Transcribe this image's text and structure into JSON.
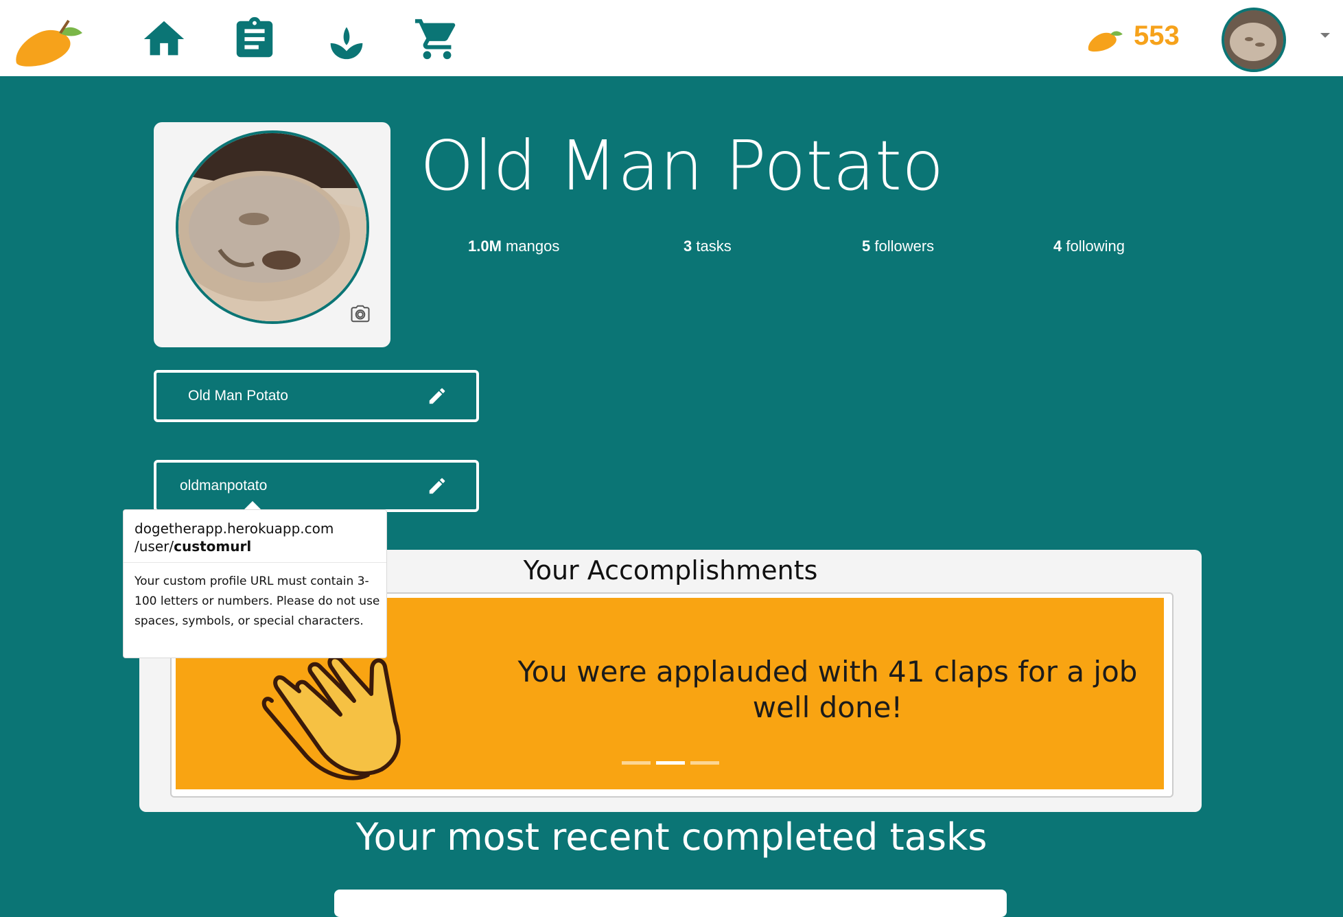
{
  "nav": {
    "mango_count": "553",
    "icons": [
      "home-icon",
      "clipboard-icon",
      "sprout-icon",
      "cart-icon"
    ]
  },
  "profile": {
    "name": "Old Man Potato",
    "stats": {
      "mangos_value": "1.0M",
      "mangos_label": "mangos",
      "tasks_value": "3",
      "tasks_label": "tasks",
      "followers_value": "5",
      "followers_label": "followers",
      "following_value": "4",
      "following_label": "following"
    },
    "display_name_field": "Old Man Potato",
    "url_field": "oldmanpotato"
  },
  "tooltip": {
    "url_prefix": "dogetherapp.herokuapp.com",
    "url_path": "/user/",
    "url_bold": "customurl",
    "body": "Your custom profile URL must contain 3-100 letters or numbers. Please do not use spaces, symbols, or special characters."
  },
  "accomplishments": {
    "title": "Your Accomplishments",
    "slide_text": "You were applauded with 41 claps for a job well done!",
    "slide_count": 3,
    "active_slide": 1
  },
  "recent": {
    "title": "Your most recent completed tasks"
  },
  "colors": {
    "teal": "#0b7575",
    "orange": "#f9a412",
    "mango": "#f6a21b"
  }
}
